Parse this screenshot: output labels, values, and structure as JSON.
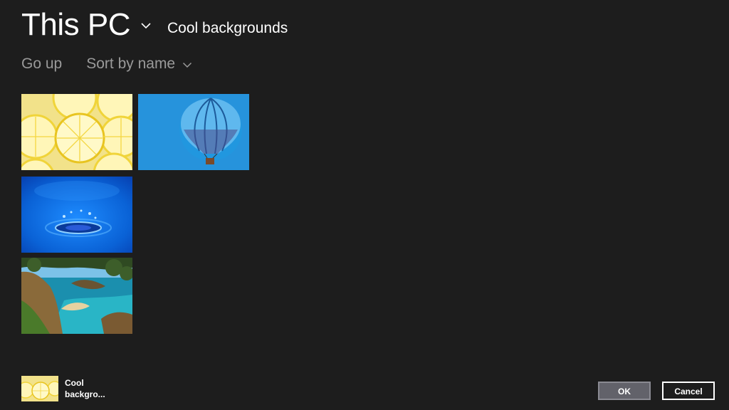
{
  "header": {
    "location": "This PC",
    "folder": "Cool backgrounds"
  },
  "toolbar": {
    "go_up": "Go up",
    "sort": "Sort by name"
  },
  "files": [
    {
      "name": "lemons"
    },
    {
      "name": "hot-air-balloon"
    },
    {
      "name": "water-drop"
    },
    {
      "name": "coastline"
    }
  ],
  "footer": {
    "selected_label": "Cool backgro...",
    "ok": "OK",
    "cancel": "Cancel"
  },
  "colors": {
    "background": "#1d1d1d",
    "secondary_text": "#9a9a9a",
    "ok_button": "#62626a"
  }
}
